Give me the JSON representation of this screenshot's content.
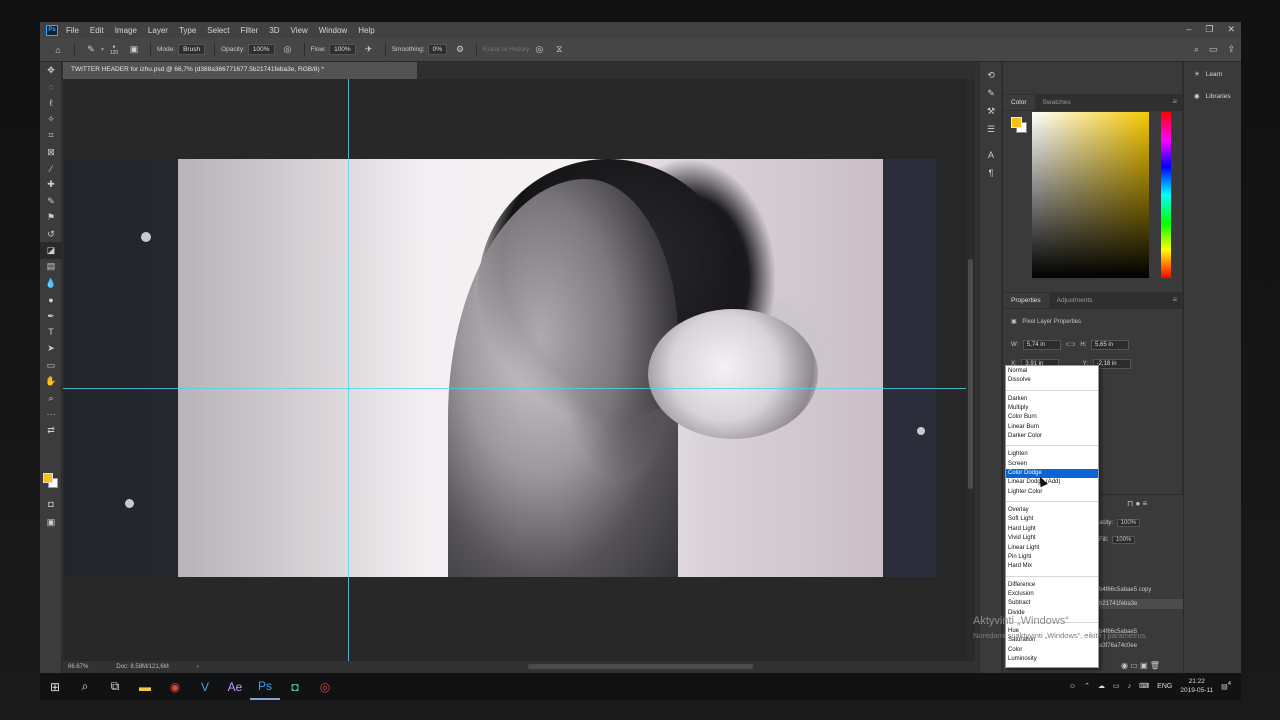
{
  "menu": {
    "logo": "Ps",
    "items": [
      "File",
      "Edit",
      "Image",
      "Layer",
      "Type",
      "Select",
      "Filter",
      "3D",
      "View",
      "Window",
      "Help"
    ]
  },
  "options": {
    "size": "120",
    "mode_label": "Mode:",
    "mode_value": "Brush",
    "opacity_label": "Opacity:",
    "opacity_value": "100%",
    "flow_label": "Flow:",
    "flow_value": "100%",
    "smoothing_label": "Smoothing:",
    "smoothing_value": "0%",
    "erase_history": "Erase to History"
  },
  "document": {
    "tab_title": "TWITTER HEADER for izhu.psd @ 66,7% (d388a366771677.5b21741feba3e, RGB/8) *",
    "zoom": "66.67%",
    "doc_info": "Doc: 8,58M/121,6M"
  },
  "color_panel": {
    "tabs": [
      "Color",
      "Swatches"
    ],
    "fg_color": "#f7c117",
    "bg_color": "#ffffff"
  },
  "properties": {
    "tabs": [
      "Properties",
      "Adjustments"
    ],
    "title": "Pixel Layer Properties",
    "w_label": "W:",
    "w_value": "5,74 in",
    "h_label": "H:",
    "h_value": "5,65 in",
    "x_label": "X:",
    "x_value": "3,91 in",
    "y_label": "Y:",
    "y_value": "-2,18 in"
  },
  "layers": {
    "opacity_label": "acity:",
    "opacity_value": "100%",
    "fill_label": "Fill:",
    "fill_value": "100%",
    "names": [
      "b4f66c5abae5 copy",
      "b21741feba3e",
      "b4f66c5abae5",
      "a3f76a74c0ee"
    ]
  },
  "blend_modes": {
    "groups": [
      [
        "Normal",
        "Dissolve"
      ],
      [
        "Darken",
        "Multiply",
        "Color Burn",
        "Linear Burn",
        "Darker Color"
      ],
      [
        "Lighten",
        "Screen",
        "Color Dodge",
        "Linear Dodge (Add)",
        "Lighter Color"
      ],
      [
        "Overlay",
        "Soft Light",
        "Hard Light",
        "Vivid Light",
        "Linear Light",
        "Pin Light",
        "Hard Mix"
      ],
      [
        "Difference",
        "Exclusion",
        "Subtract",
        "Divide"
      ],
      [
        "Hue",
        "Saturation",
        "Color",
        "Luminosity"
      ]
    ],
    "highlighted": "Color Dodge"
  },
  "learn": {
    "items": [
      "Learn",
      "Libraries"
    ]
  },
  "watermark": {
    "line1": "Aktyvinti „Windows“",
    "line2": "Norėdami suaktyvinti „Windows“, eikite į parametrus."
  },
  "taskbar": {
    "lang": "ENG",
    "time": "21:22",
    "date": "2019-05-11",
    "notif_count": "4"
  }
}
